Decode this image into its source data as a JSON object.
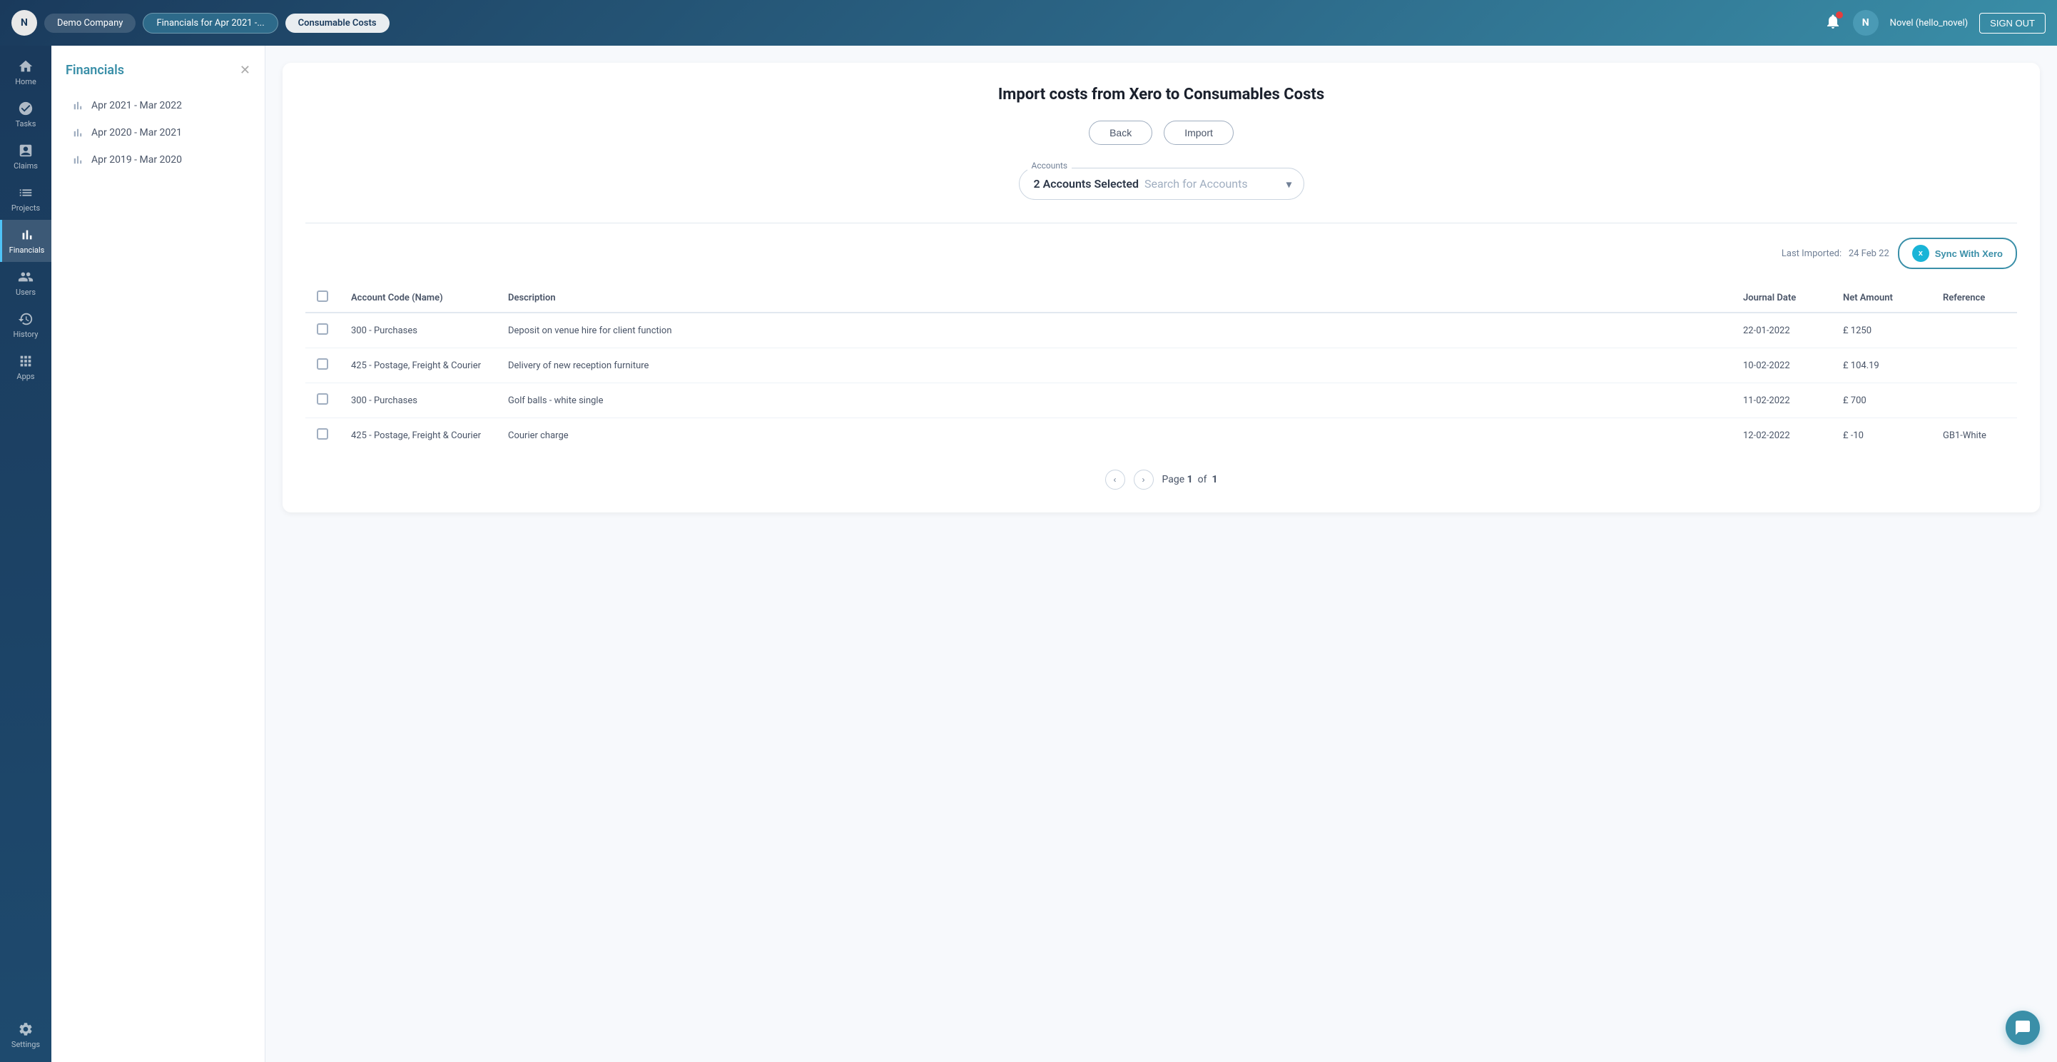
{
  "topbar": {
    "company_initial": "N",
    "company_name": "Demo Company",
    "tab1": "Financials for Apr 2021 -...",
    "tab2": "Consumable Costs",
    "user_initial": "N",
    "user_name": "Novel (hello_novel)",
    "signout_label": "SIGN OUT"
  },
  "sidebar": {
    "items": [
      {
        "id": "home",
        "label": "Home"
      },
      {
        "id": "tasks",
        "label": "Tasks"
      },
      {
        "id": "claims",
        "label": "Claims"
      },
      {
        "id": "projects",
        "label": "Projects"
      },
      {
        "id": "financials",
        "label": "Financials"
      },
      {
        "id": "users",
        "label": "Users"
      },
      {
        "id": "history",
        "label": "History"
      },
      {
        "id": "apps",
        "label": "Apps"
      },
      {
        "id": "settings",
        "label": "Settings"
      }
    ]
  },
  "panel": {
    "title": "Financials",
    "periods": [
      {
        "label": "Apr 2021 - Mar 2022"
      },
      {
        "label": "Apr 2020 - Mar 2021"
      },
      {
        "label": "Apr 2019 - Mar 2020"
      }
    ]
  },
  "main": {
    "page_title": "Import costs from Xero to Consumables Costs",
    "back_label": "Back",
    "import_label": "Import",
    "accounts_label": "Accounts",
    "accounts_selected": "2 Accounts Selected",
    "accounts_placeholder": "Search for Accounts",
    "last_imported_label": "Last Imported:",
    "last_imported_date": "24 Feb 22",
    "sync_label": "Sync With Xero",
    "table": {
      "columns": [
        "Account Code (Name)",
        "Description",
        "Journal Date",
        "Net Amount",
        "Reference"
      ],
      "rows": [
        {
          "account": "300 - Purchases",
          "description": "Deposit on venue hire for client function",
          "date": "22-01-2022",
          "amount": "£  1250",
          "reference": ""
        },
        {
          "account": "425 - Postage, Freight & Courier",
          "description": "Delivery of new reception furniture",
          "date": "10-02-2022",
          "amount": "£  104.19",
          "reference": ""
        },
        {
          "account": "300 - Purchases",
          "description": "Golf balls - white single",
          "date": "11-02-2022",
          "amount": "£  700",
          "reference": ""
        },
        {
          "account": "425 - Postage, Freight & Courier",
          "description": "Courier charge",
          "date": "12-02-2022",
          "amount": "£  -10",
          "reference": "GB1-White"
        }
      ]
    },
    "pagination": {
      "page_label": "Page",
      "current": "1",
      "total": "1",
      "of_label": "of"
    }
  }
}
